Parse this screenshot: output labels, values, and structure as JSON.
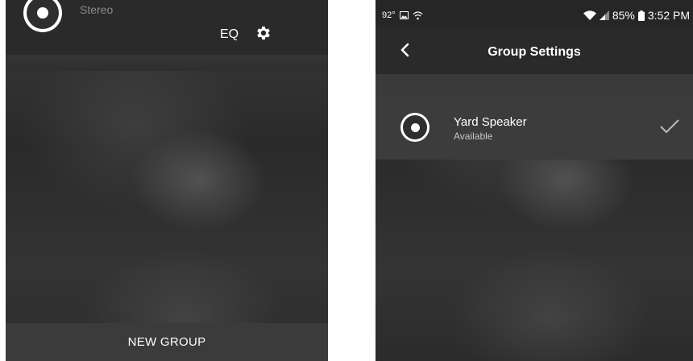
{
  "left_screen": {
    "group_type": "Stereo",
    "eq_label": "EQ",
    "new_group_label": "NEW GROUP"
  },
  "right_screen": {
    "status_bar": {
      "temperature": "92°",
      "battery_percent": "85%",
      "time": "3:52 PM"
    },
    "title": "Group Settings",
    "speakers": [
      {
        "name": "Yard Speaker",
        "status": "Available",
        "selected": true
      }
    ]
  },
  "icons": {
    "speaker": "speaker-icon",
    "settings": "gear-icon",
    "back": "chevron-left-icon",
    "selected": "checkmark-icon",
    "wifi": "wifi-icon",
    "signal": "signal-icon",
    "battery": "battery-icon",
    "gallery": "image-icon"
  },
  "colors": {
    "background": "#2d2d2d",
    "row": "#3c3c3c",
    "text": "#ffffff",
    "secondary_text": "#c6c6c6"
  }
}
